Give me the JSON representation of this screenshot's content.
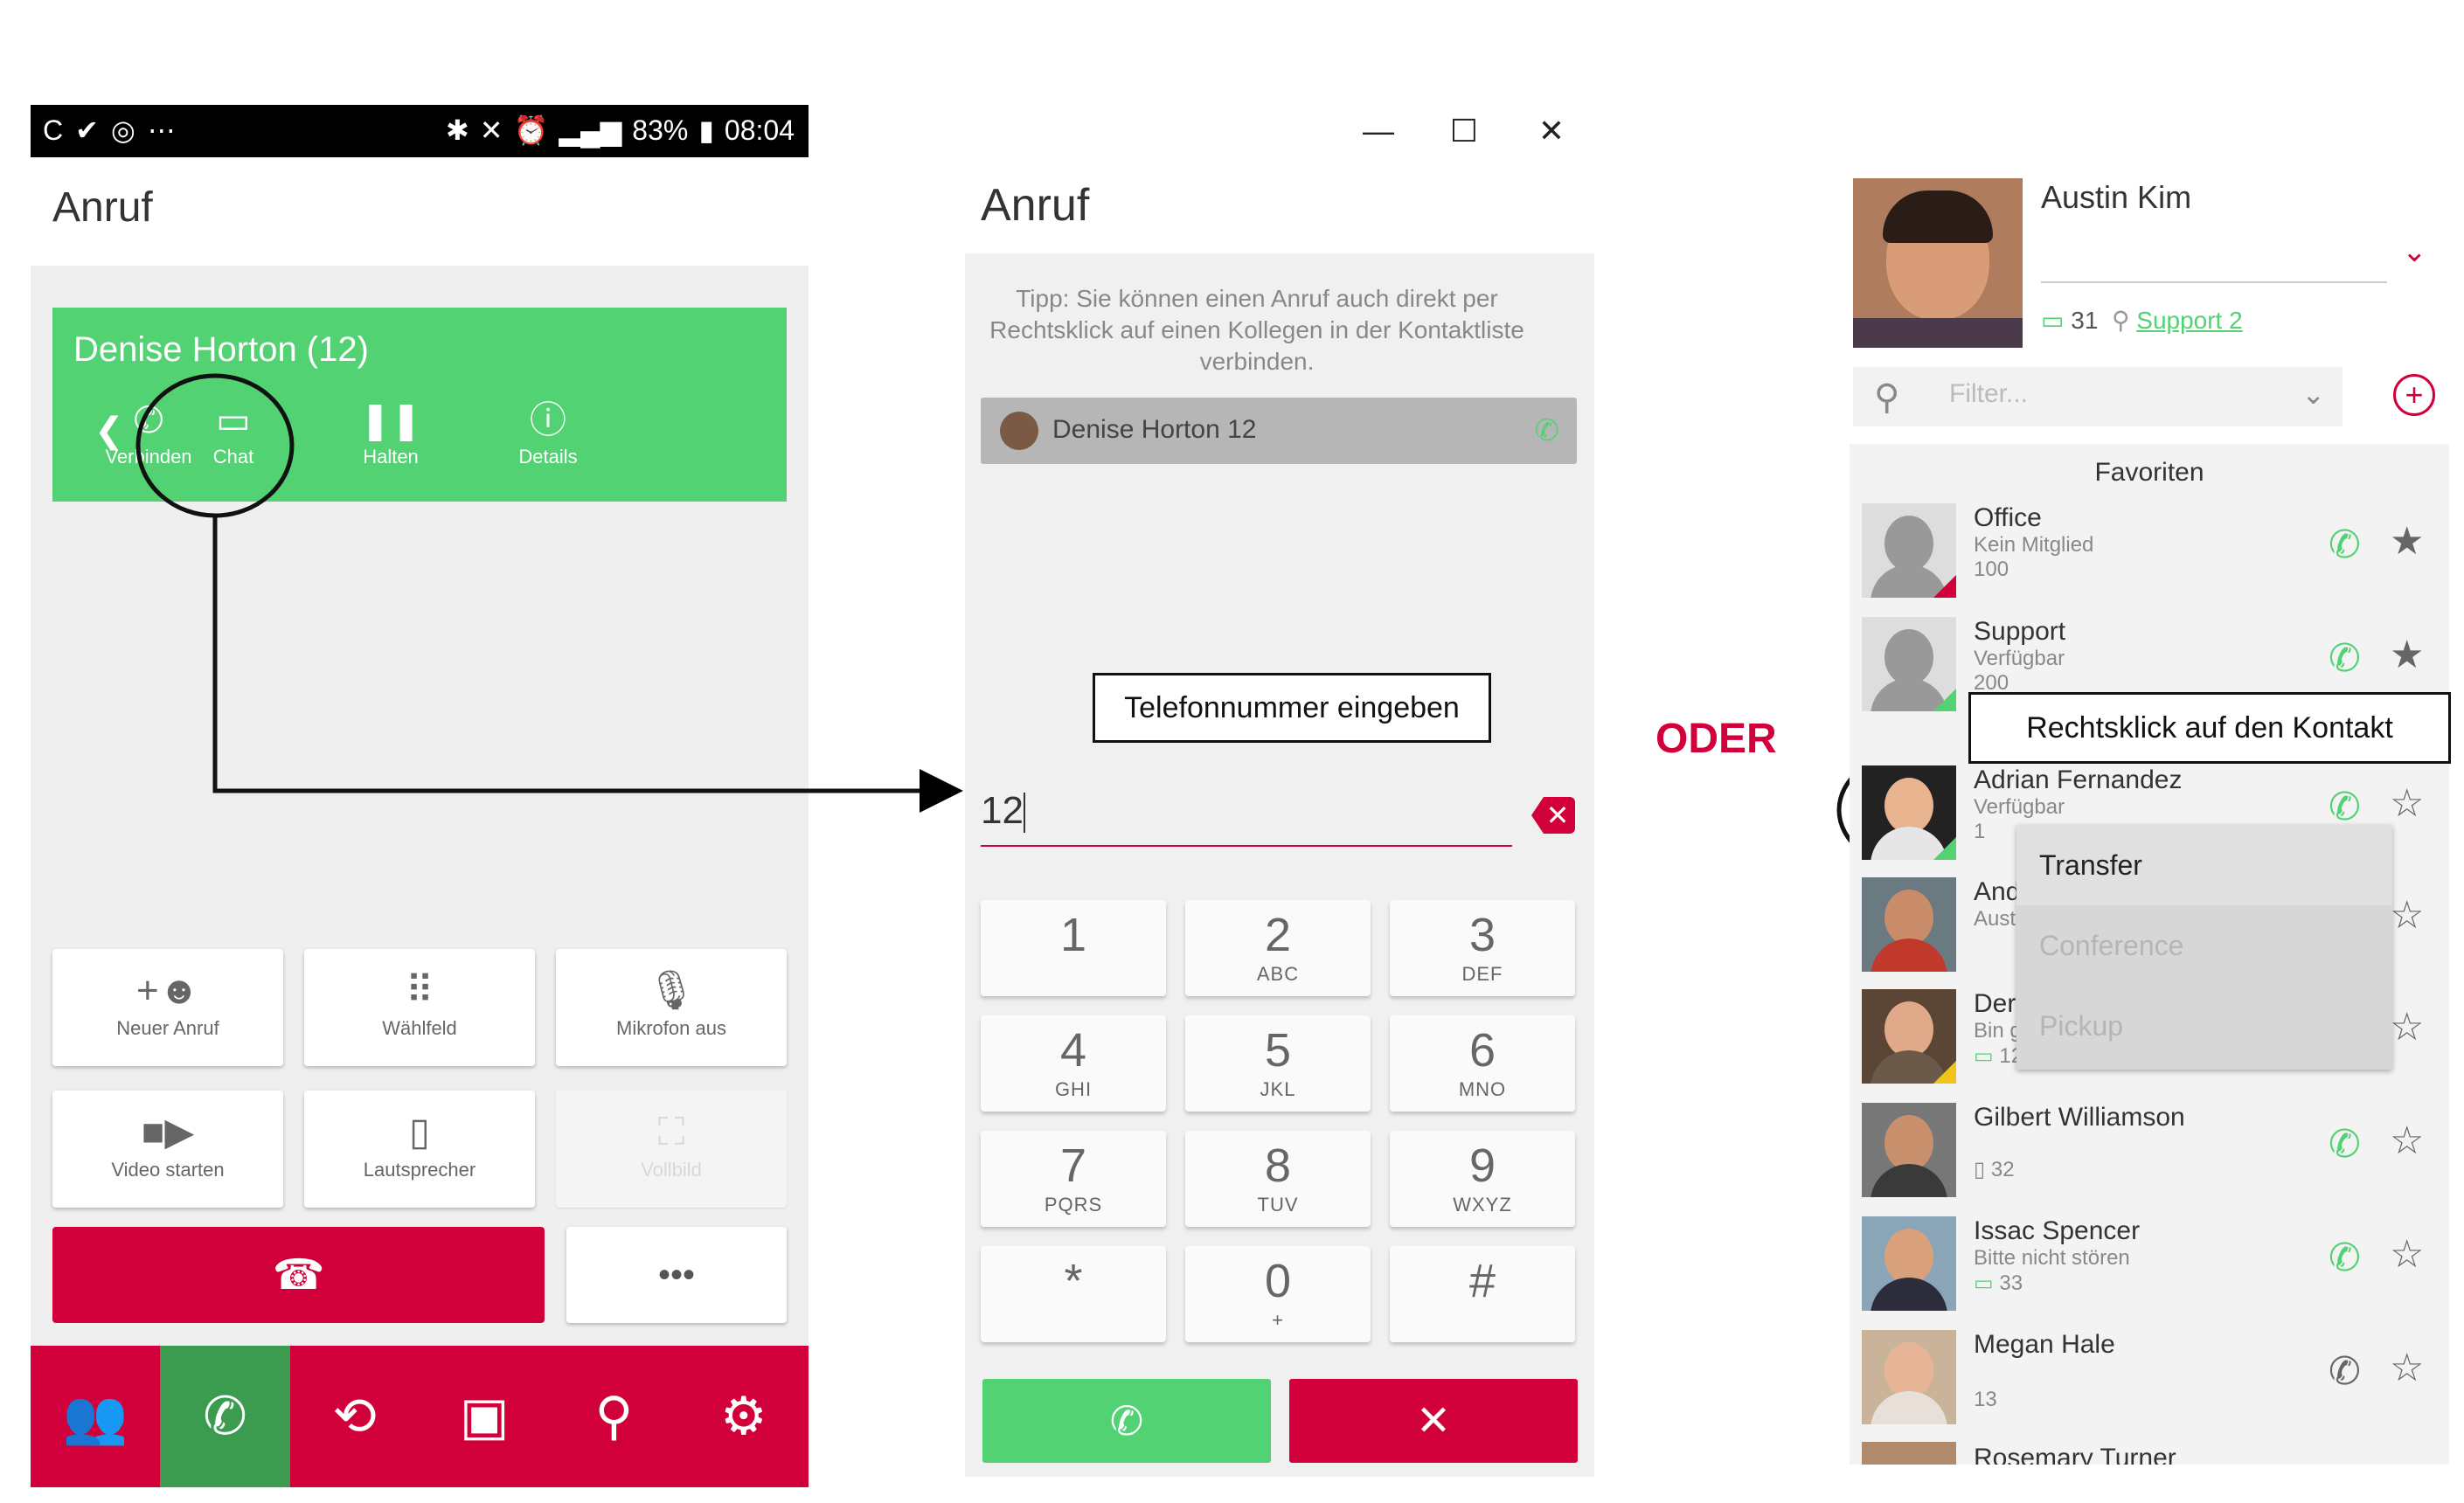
{
  "phone": {
    "status_left_icons": [
      "sync-icon",
      "check-icon",
      "pin-icon"
    ],
    "status_more": "⋯",
    "battery": "83%",
    "time": "08:04",
    "title": "Anruf",
    "call_card": {
      "name": "Denise Horton (12)",
      "buttons": [
        {
          "label": "Verbinden",
          "icon": "transfer-icon"
        },
        {
          "label": "Chat",
          "icon": "chat-icon"
        },
        {
          "label": "Halten",
          "icon": "pause-icon"
        },
        {
          "label": "Details",
          "icon": "info-icon"
        }
      ]
    },
    "actions": [
      {
        "label": "Neuer Anruf",
        "icon": "add-person-icon"
      },
      {
        "label": "Wählfeld",
        "icon": "dialpad-icon"
      },
      {
        "label": "Mikrofon aus",
        "icon": "microphone-icon"
      },
      {
        "label": "Video starten",
        "icon": "video-icon"
      },
      {
        "label": "Lautsprecher",
        "icon": "speaker-icon"
      },
      {
        "label": "Vollbild",
        "icon": "fullscreen-icon"
      }
    ],
    "more_label": "•••",
    "nav_icons": [
      "people-icon",
      "phone-icon",
      "history-icon",
      "contacts-icon",
      "search-icon",
      "settings-icon"
    ],
    "nav_active": 1
  },
  "middle": {
    "title": "Anruf",
    "tip": "Tipp: Sie können einen Anruf auch direkt per Rechtsklick auf einen Kollegen in der Kontaktliste verbinden.",
    "contact_bar": "Denise Horton 12",
    "callout": "Telefonnummer eingeben",
    "number_value": "12",
    "keys": [
      {
        "digit": "1",
        "letters": ""
      },
      {
        "digit": "2",
        "letters": "ABC"
      },
      {
        "digit": "3",
        "letters": "DEF"
      },
      {
        "digit": "4",
        "letters": "GHI"
      },
      {
        "digit": "5",
        "letters": "JKL"
      },
      {
        "digit": "6",
        "letters": "MNO"
      },
      {
        "digit": "7",
        "letters": "PQRS"
      },
      {
        "digit": "8",
        "letters": "TUV"
      },
      {
        "digit": "9",
        "letters": "WXYZ"
      },
      {
        "digit": "*",
        "letters": ""
      },
      {
        "digit": "0",
        "letters": "+"
      },
      {
        "digit": "#",
        "letters": ""
      }
    ]
  },
  "oder": "ODER",
  "right": {
    "user_name": "Austin Kim",
    "ext": "31",
    "location_link": "Support 2",
    "filter_placeholder": "Filter...",
    "favorites_header": "Favoriten",
    "callout": "Rechtsklick auf den Kontakt",
    "contacts": [
      {
        "name": "Office",
        "status": "Kein Mitglied",
        "ext": "100",
        "starred": true
      },
      {
        "name": "Support",
        "status": "Verfügbar",
        "ext": "200",
        "starred": true
      },
      {
        "name": "Adrian Fernandez",
        "status": "Verfügbar",
        "ext": "1",
        "starred": false
      },
      {
        "name": "And",
        "status": "Aust",
        "ext": "",
        "starred": false
      },
      {
        "name": "Der",
        "status": "Bin g",
        "ext": "12",
        "starred": false
      },
      {
        "name": "Gilbert Williamson",
        "status": "",
        "ext": "32",
        "starred": false
      },
      {
        "name": "Issac Spencer",
        "status": "Bitte nicht stören",
        "ext": "33",
        "starred": false
      },
      {
        "name": "Megan Hale",
        "status": "",
        "ext": "13",
        "starred": false
      },
      {
        "name": "Rosemary Turner",
        "status": "",
        "ext": "",
        "starred": false
      }
    ],
    "context_menu": [
      "Transfer",
      "Conference",
      "Pickup"
    ]
  },
  "colors": {
    "green": "#52d273",
    "red": "#d2003a",
    "dark_green": "#3b9b4f"
  }
}
